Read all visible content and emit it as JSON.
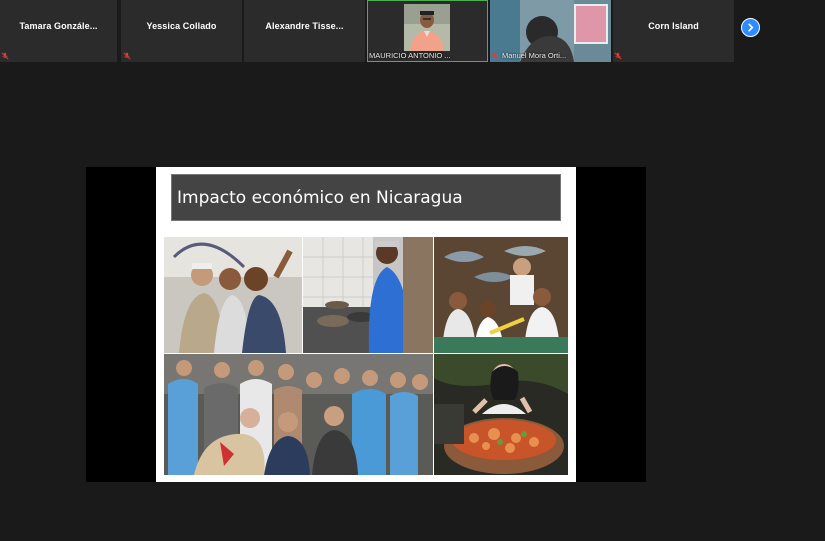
{
  "participants": [
    {
      "name": "Tamara  Gonzále...",
      "muted": true,
      "video": false
    },
    {
      "name": "Yessica Collado",
      "muted": true,
      "video": false
    },
    {
      "name": "Alexandre  Tisse...",
      "muted": false,
      "video": false
    },
    {
      "name": "MAURICIO ANTONIO ...",
      "muted": false,
      "video": true,
      "active": true
    },
    {
      "name": "Manuel Mora Orti...",
      "muted": true,
      "video": true
    },
    {
      "name": "Corn Island",
      "muted": true,
      "video": false
    }
  ],
  "icons": {
    "mute": "microphone-muted-icon",
    "next": "chevron-right-icon"
  },
  "colors": {
    "background": "#1a1a1a",
    "tile": "#2b2b2b",
    "accent": "#2d8cff",
    "active_border": "#4caf50",
    "mute": "#e53935"
  },
  "slide": {
    "title": "Impacto económico en Nicaragua"
  }
}
